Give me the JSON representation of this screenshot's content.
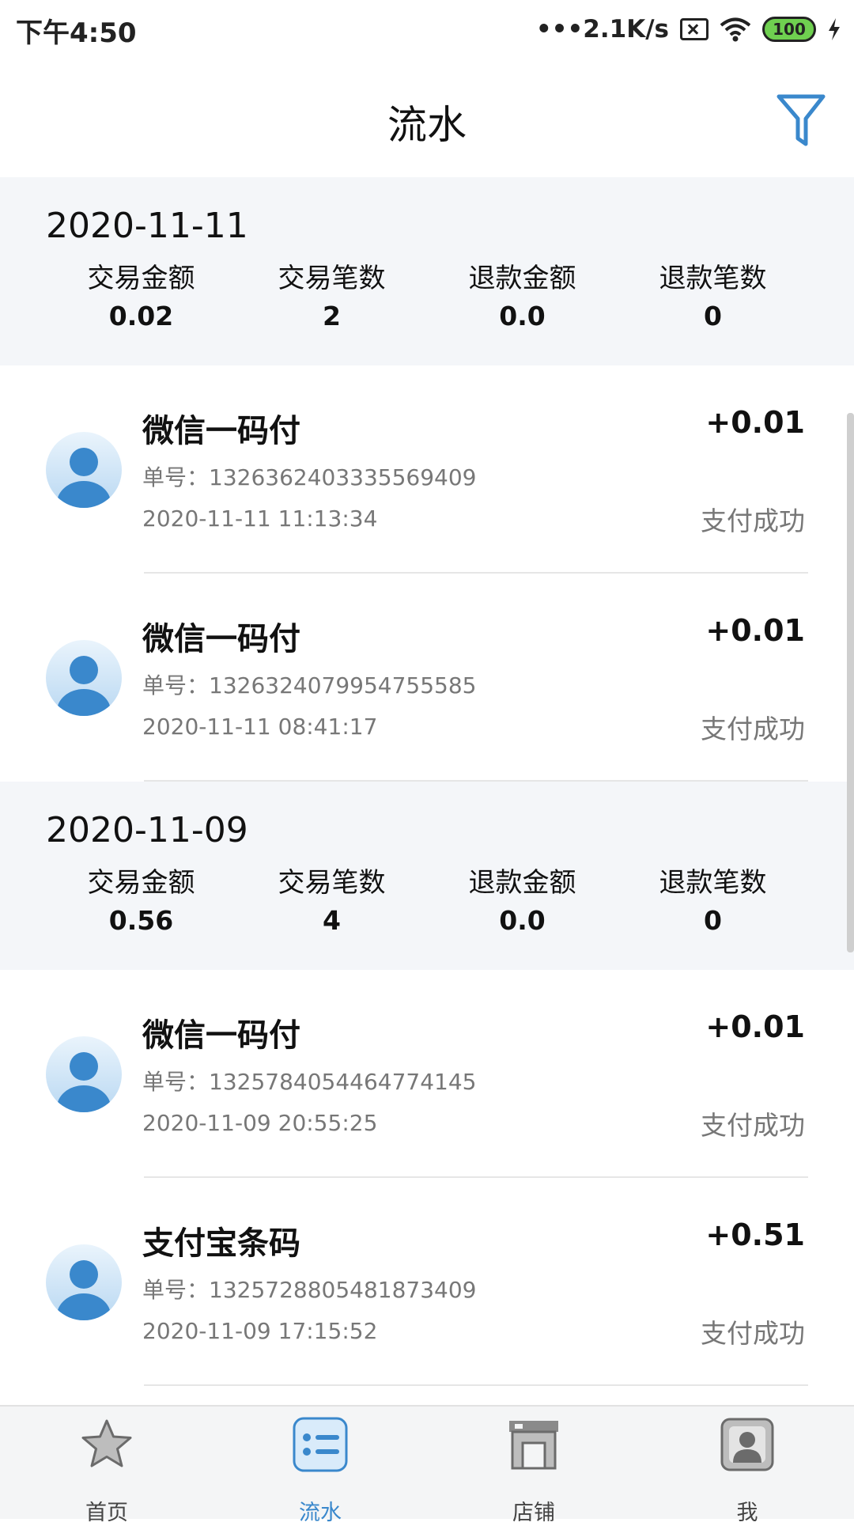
{
  "status_bar": {
    "time": "下午4:50",
    "net_speed": "•••2.1K/s",
    "battery": "100"
  },
  "header": {
    "title": "流水"
  },
  "groups": [
    {
      "date": "2020-11-11",
      "stats": [
        {
          "label": "交易金额",
          "value": "0.02"
        },
        {
          "label": "交易笔数",
          "value": "2"
        },
        {
          "label": "退款金额",
          "value": "0.0"
        },
        {
          "label": "退款笔数",
          "value": "0"
        }
      ],
      "transactions": [
        {
          "name": "微信一码付",
          "order": "单号：1326362403335569409",
          "time": "2020-11-11 11:13:34",
          "amount": "+0.01",
          "status": "支付成功"
        },
        {
          "name": "微信一码付",
          "order": "单号：1326324079954755585",
          "time": "2020-11-11 08:41:17",
          "amount": "+0.01",
          "status": "支付成功"
        }
      ]
    },
    {
      "date": "2020-11-09",
      "stats": [
        {
          "label": "交易金额",
          "value": "0.56"
        },
        {
          "label": "交易笔数",
          "value": "4"
        },
        {
          "label": "退款金额",
          "value": "0.0"
        },
        {
          "label": "退款笔数",
          "value": "0"
        }
      ],
      "transactions": [
        {
          "name": "微信一码付",
          "order": "单号：1325784054464774145",
          "time": "2020-11-09 20:55:25",
          "amount": "+0.01",
          "status": "支付成功"
        },
        {
          "name": "支付宝条码",
          "order": "单号：1325728805481873409",
          "time": "2020-11-09 17:15:52",
          "amount": "+0.51",
          "status": "支付成功"
        }
      ]
    }
  ],
  "tabbar": {
    "tabs": [
      {
        "label": "首页",
        "icon": "star-icon"
      },
      {
        "label": "流水",
        "icon": "list-icon"
      },
      {
        "label": "店铺",
        "icon": "store-icon"
      },
      {
        "label": "我",
        "icon": "profile-icon"
      }
    ],
    "active_index": 1
  },
  "colors": {
    "accent": "#3a88cc",
    "summary_bg": "#f4f6f9",
    "muted_text": "#777777"
  }
}
